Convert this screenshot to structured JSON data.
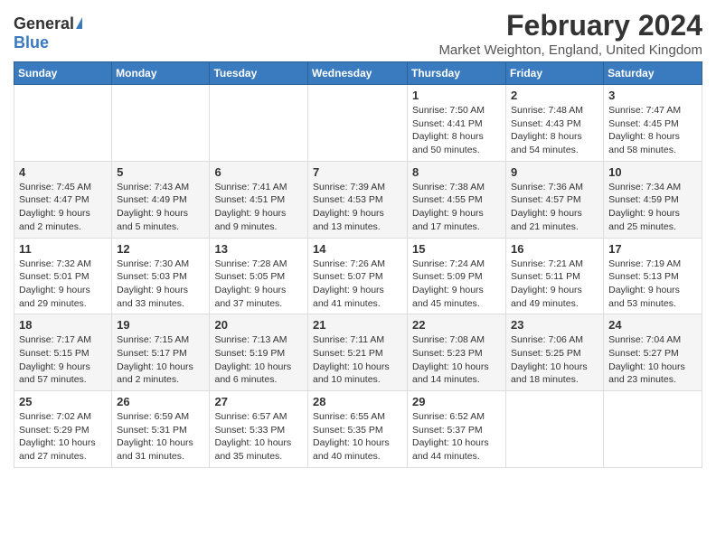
{
  "logo": {
    "general": "General",
    "blue": "Blue"
  },
  "title": "February 2024",
  "location": "Market Weighton, England, United Kingdom",
  "days_of_week": [
    "Sunday",
    "Monday",
    "Tuesday",
    "Wednesday",
    "Thursday",
    "Friday",
    "Saturday"
  ],
  "weeks": [
    [
      {
        "day": "",
        "info": ""
      },
      {
        "day": "",
        "info": ""
      },
      {
        "day": "",
        "info": ""
      },
      {
        "day": "",
        "info": ""
      },
      {
        "day": "1",
        "info": "Sunrise: 7:50 AM\nSunset: 4:41 PM\nDaylight: 8 hours\nand 50 minutes."
      },
      {
        "day": "2",
        "info": "Sunrise: 7:48 AM\nSunset: 4:43 PM\nDaylight: 8 hours\nand 54 minutes."
      },
      {
        "day": "3",
        "info": "Sunrise: 7:47 AM\nSunset: 4:45 PM\nDaylight: 8 hours\nand 58 minutes."
      }
    ],
    [
      {
        "day": "4",
        "info": "Sunrise: 7:45 AM\nSunset: 4:47 PM\nDaylight: 9 hours\nand 2 minutes."
      },
      {
        "day": "5",
        "info": "Sunrise: 7:43 AM\nSunset: 4:49 PM\nDaylight: 9 hours\nand 5 minutes."
      },
      {
        "day": "6",
        "info": "Sunrise: 7:41 AM\nSunset: 4:51 PM\nDaylight: 9 hours\nand 9 minutes."
      },
      {
        "day": "7",
        "info": "Sunrise: 7:39 AM\nSunset: 4:53 PM\nDaylight: 9 hours\nand 13 minutes."
      },
      {
        "day": "8",
        "info": "Sunrise: 7:38 AM\nSunset: 4:55 PM\nDaylight: 9 hours\nand 17 minutes."
      },
      {
        "day": "9",
        "info": "Sunrise: 7:36 AM\nSunset: 4:57 PM\nDaylight: 9 hours\nand 21 minutes."
      },
      {
        "day": "10",
        "info": "Sunrise: 7:34 AM\nSunset: 4:59 PM\nDaylight: 9 hours\nand 25 minutes."
      }
    ],
    [
      {
        "day": "11",
        "info": "Sunrise: 7:32 AM\nSunset: 5:01 PM\nDaylight: 9 hours\nand 29 minutes."
      },
      {
        "day": "12",
        "info": "Sunrise: 7:30 AM\nSunset: 5:03 PM\nDaylight: 9 hours\nand 33 minutes."
      },
      {
        "day": "13",
        "info": "Sunrise: 7:28 AM\nSunset: 5:05 PM\nDaylight: 9 hours\nand 37 minutes."
      },
      {
        "day": "14",
        "info": "Sunrise: 7:26 AM\nSunset: 5:07 PM\nDaylight: 9 hours\nand 41 minutes."
      },
      {
        "day": "15",
        "info": "Sunrise: 7:24 AM\nSunset: 5:09 PM\nDaylight: 9 hours\nand 45 minutes."
      },
      {
        "day": "16",
        "info": "Sunrise: 7:21 AM\nSunset: 5:11 PM\nDaylight: 9 hours\nand 49 minutes."
      },
      {
        "day": "17",
        "info": "Sunrise: 7:19 AM\nSunset: 5:13 PM\nDaylight: 9 hours\nand 53 minutes."
      }
    ],
    [
      {
        "day": "18",
        "info": "Sunrise: 7:17 AM\nSunset: 5:15 PM\nDaylight: 9 hours\nand 57 minutes."
      },
      {
        "day": "19",
        "info": "Sunrise: 7:15 AM\nSunset: 5:17 PM\nDaylight: 10 hours\nand 2 minutes."
      },
      {
        "day": "20",
        "info": "Sunrise: 7:13 AM\nSunset: 5:19 PM\nDaylight: 10 hours\nand 6 minutes."
      },
      {
        "day": "21",
        "info": "Sunrise: 7:11 AM\nSunset: 5:21 PM\nDaylight: 10 hours\nand 10 minutes."
      },
      {
        "day": "22",
        "info": "Sunrise: 7:08 AM\nSunset: 5:23 PM\nDaylight: 10 hours\nand 14 minutes."
      },
      {
        "day": "23",
        "info": "Sunrise: 7:06 AM\nSunset: 5:25 PM\nDaylight: 10 hours\nand 18 minutes."
      },
      {
        "day": "24",
        "info": "Sunrise: 7:04 AM\nSunset: 5:27 PM\nDaylight: 10 hours\nand 23 minutes."
      }
    ],
    [
      {
        "day": "25",
        "info": "Sunrise: 7:02 AM\nSunset: 5:29 PM\nDaylight: 10 hours\nand 27 minutes."
      },
      {
        "day": "26",
        "info": "Sunrise: 6:59 AM\nSunset: 5:31 PM\nDaylight: 10 hours\nand 31 minutes."
      },
      {
        "day": "27",
        "info": "Sunrise: 6:57 AM\nSunset: 5:33 PM\nDaylight: 10 hours\nand 35 minutes."
      },
      {
        "day": "28",
        "info": "Sunrise: 6:55 AM\nSunset: 5:35 PM\nDaylight: 10 hours\nand 40 minutes."
      },
      {
        "day": "29",
        "info": "Sunrise: 6:52 AM\nSunset: 5:37 PM\nDaylight: 10 hours\nand 44 minutes."
      },
      {
        "day": "",
        "info": ""
      },
      {
        "day": "",
        "info": ""
      }
    ]
  ]
}
